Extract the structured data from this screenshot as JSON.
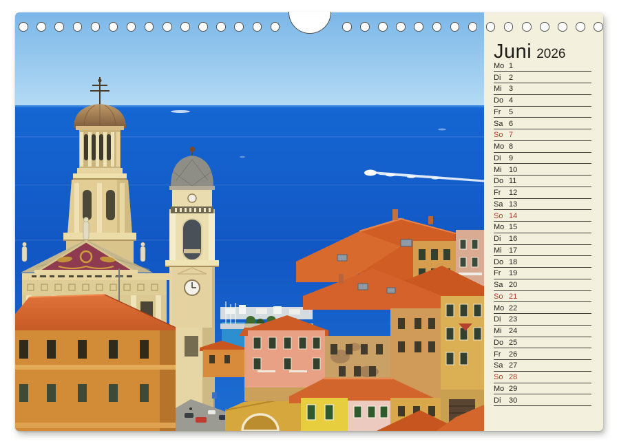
{
  "calendar": {
    "month": "Juni",
    "year": "2026",
    "panel_bg": "#f4f0de",
    "text_color": "#23221c",
    "weekend_color": "#b23a2c",
    "line_color": "#3f3e36",
    "days": [
      {
        "label": "Mo",
        "num": "1",
        "weekend": false
      },
      {
        "label": "Di",
        "num": "2",
        "weekend": false
      },
      {
        "label": "Mi",
        "num": "3",
        "weekend": false
      },
      {
        "label": "Do",
        "num": "4",
        "weekend": false
      },
      {
        "label": "Fr",
        "num": "5",
        "weekend": false
      },
      {
        "label": "Sa",
        "num": "6",
        "weekend": false
      },
      {
        "label": "So",
        "num": "7",
        "weekend": true
      },
      {
        "label": "Mo",
        "num": "8",
        "weekend": false
      },
      {
        "label": "Di",
        "num": "9",
        "weekend": false
      },
      {
        "label": "Mi",
        "num": "10",
        "weekend": false
      },
      {
        "label": "Do",
        "num": "11",
        "weekend": false
      },
      {
        "label": "Fr",
        "num": "12",
        "weekend": false
      },
      {
        "label": "Sa",
        "num": "13",
        "weekend": false
      },
      {
        "label": "So",
        "num": "14",
        "weekend": true
      },
      {
        "label": "Mo",
        "num": "15",
        "weekend": false
      },
      {
        "label": "Di",
        "num": "16",
        "weekend": false
      },
      {
        "label": "Mi",
        "num": "17",
        "weekend": false
      },
      {
        "label": "Do",
        "num": "18",
        "weekend": false
      },
      {
        "label": "Fr",
        "num": "19",
        "weekend": false
      },
      {
        "label": "Sa",
        "num": "20",
        "weekend": false
      },
      {
        "label": "So",
        "num": "21",
        "weekend": true
      },
      {
        "label": "Mo",
        "num": "22",
        "weekend": false
      },
      {
        "label": "Di",
        "num": "23",
        "weekend": false
      },
      {
        "label": "Mi",
        "num": "24",
        "weekend": false
      },
      {
        "label": "Do",
        "num": "25",
        "weekend": false
      },
      {
        "label": "Fr",
        "num": "26",
        "weekend": false
      },
      {
        "label": "Sa",
        "num": "27",
        "weekend": false
      },
      {
        "label": "So",
        "num": "28",
        "weekend": true
      },
      {
        "label": "Mo",
        "num": "29",
        "weekend": false
      },
      {
        "label": "Di",
        "num": "30",
        "weekend": false
      }
    ]
  },
  "photo": {
    "alt": "Mediterranean coastal town with baroque church dome, bell tower, terracotta roofs and deep blue sea"
  }
}
